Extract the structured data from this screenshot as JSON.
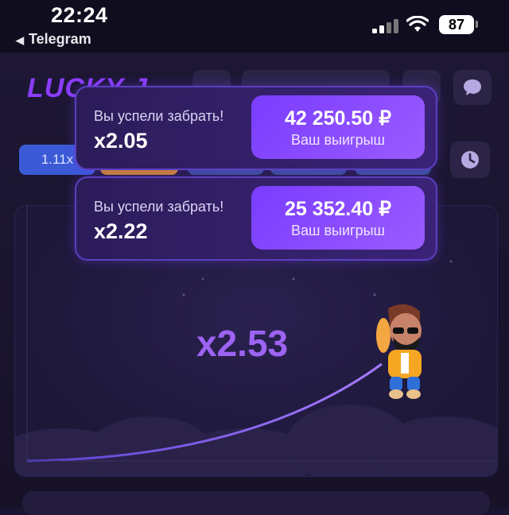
{
  "status": {
    "time": "22:24",
    "back_app": "Telegram",
    "battery": "87"
  },
  "header": {
    "logo": "LUCKY J"
  },
  "history": {
    "first_chip": "1.11x"
  },
  "game": {
    "multiplier": "x2.53"
  },
  "toasts": [
    {
      "message": "Вы успели забрать!",
      "multiplier": "x2.05",
      "amount": "42 250.50 ₽",
      "amount_label": "Ваш выигрыш"
    },
    {
      "message": "Вы успели забрать!",
      "multiplier": "x2.22",
      "amount": "25 352.40 ₽",
      "amount_label": "Ваш выигрыш"
    }
  ],
  "colors": {
    "accent": "#8b3dff",
    "multiplier": "#9d63f2",
    "chip_first": "#3b5ad6",
    "chip_orange": "#d9891a"
  },
  "icons": [
    "back-arrow-icon",
    "signal-icon",
    "wifi-icon",
    "battery-icon",
    "chat-icon",
    "clock-icon"
  ]
}
